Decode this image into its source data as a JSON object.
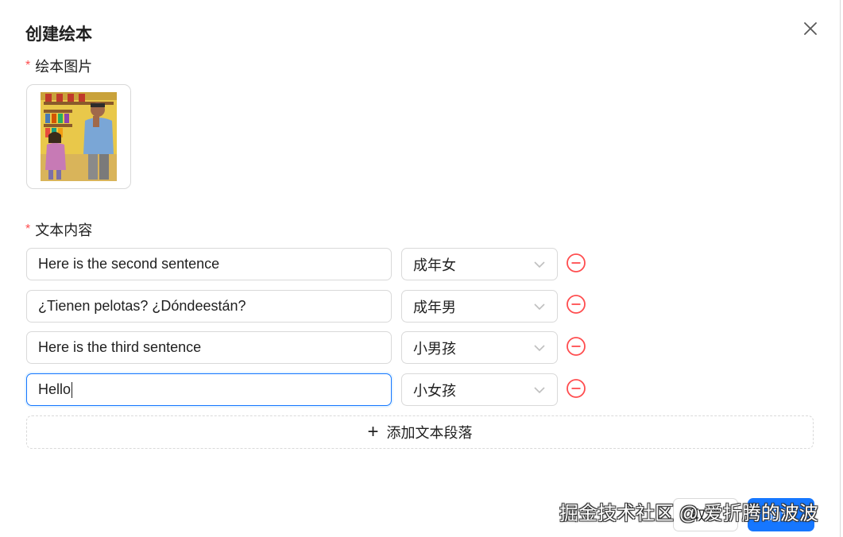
{
  "modal": {
    "title": "创建绘本",
    "close_icon": "close-icon"
  },
  "image_field": {
    "required_mark": "*",
    "label": "绘本图片",
    "thumbnail_icon": "picture-book-illustration"
  },
  "text_field": {
    "required_mark": "*",
    "label": "文本内容",
    "rows": [
      {
        "text": "Here is the second sentence",
        "voice": "成年女"
      },
      {
        "text": "¿Tienen pelotas? ¿Dóndeestán?",
        "voice": "成年男"
      },
      {
        "text": "Here is the third sentence",
        "voice": "小男孩"
      },
      {
        "text": "Hello",
        "voice": "小女孩"
      }
    ],
    "add_button_label": "添加文本段落",
    "remove_icon": "minus-circle-icon",
    "dropdown_icon": "chevron-down-icon"
  },
  "footer": {
    "cancel_label": "取消",
    "ok_label": "确认"
  },
  "watermark": "掘金技术社区 @ 爱折腾的波波",
  "colors": {
    "primary": "#1677ff",
    "danger": "#ff4d4f",
    "border": "#d9d9d9"
  }
}
